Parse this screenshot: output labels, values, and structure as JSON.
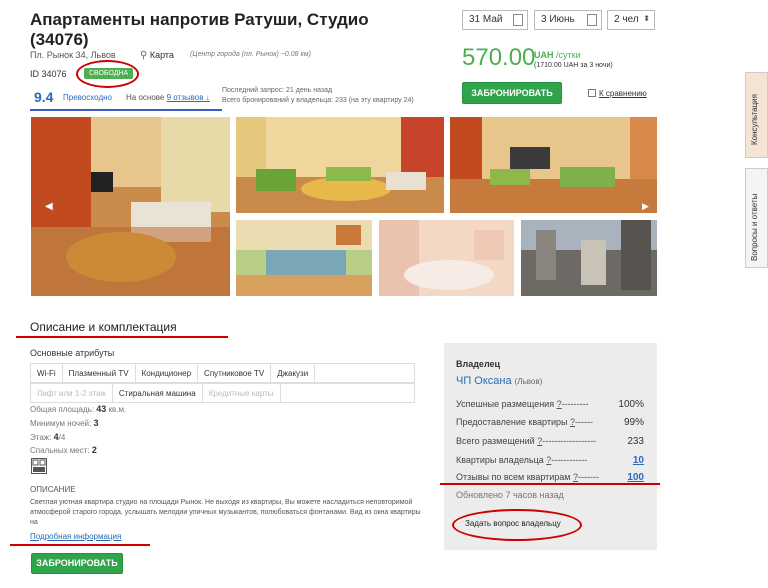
{
  "listing": {
    "title": "Апартаменты напротив Ратуши, Студио (34076)",
    "address": "Пл. Рынок 34, Львов",
    "map_label": "Карта",
    "center_note": "(Центр города (пл. Рынок) ~0.08 км)",
    "id_label": "ID 34076",
    "status_badge": "свободна",
    "rating_score": "9.4",
    "rating_word": "Превосходно",
    "reviews_prefix": "На основе",
    "reviews_link": "9 отзывов ↓",
    "last_request": "Последний запрос: 21 день назад",
    "total_bookings": "Всего бронирований у владельца: 233 (на эту квартиру 24)"
  },
  "booking": {
    "date_from": "31 Май",
    "date_to": "3 Июнь",
    "guests": "2 чел",
    "price": "570.00",
    "currency": "UAH",
    "per": "/сутки",
    "price_total": "(1710.00 UAH за 3 ночи)",
    "book_label": "ЗАБРОНИРОВАТЬ",
    "compare_label": "К сравнению"
  },
  "side_tabs": {
    "consult": "Консультация",
    "questions": "Вопросы и ответы"
  },
  "details": {
    "section_title": "Описание и комплектация",
    "attributes_title": "Основные атрибуты",
    "amenities_row1": [
      "Wi-Fi",
      "Плазменный TV",
      "Кондиционер",
      "Спутниковое TV",
      "Джакузи"
    ],
    "amenities_row2": [
      "Лифт или 1-2 этаж",
      "Стиральная машина",
      "Кредитные карты"
    ],
    "area_label": "Общая площадь:",
    "area_value": "43",
    "area_unit": "кв.м.",
    "min_nights_label": "Минимум ночей:",
    "min_nights_value": "3",
    "floor_label": "Этаж:",
    "floor_value": "4",
    "floor_total": "/4",
    "beds_label": "Спальных мест:",
    "beds_value": "2",
    "description_head": "ОПИСАНИЕ",
    "description": "Светлая уютная квартира студио на площади Рынок. Не выходя из квартиры, Вы можете насладиться неповторимой атмосферой старого города, услышать мелодии уличных музыкантов, полюбоваться фонтанами. Вид из окна квартиры на",
    "more_link": "Подробная информация",
    "book_label": "ЗАБРОНИРОВАТЬ"
  },
  "owner": {
    "title": "Владелец",
    "name": "ЧП Оксана",
    "city": "(Львов)",
    "rows": [
      {
        "label": "Успешные размещения",
        "q": "?",
        "dashes": "---------",
        "value": "100%"
      },
      {
        "label": "Предоставление квартиры",
        "q": "?",
        "dashes": "------",
        "value": "99%"
      },
      {
        "label": "Всего размещений",
        "q": "?",
        "dashes": "------------------",
        "value": "233"
      },
      {
        "label": "Квартиры владельца",
        "q": "?",
        "dashes": "------------",
        "value": "10"
      },
      {
        "label": "Отзывы по всем квартирам",
        "q": "?",
        "dashes": "-------",
        "value": "100"
      }
    ],
    "updated": "Обновлено 7 часов назад",
    "ask_label": "Задать вопрос владельцу"
  }
}
